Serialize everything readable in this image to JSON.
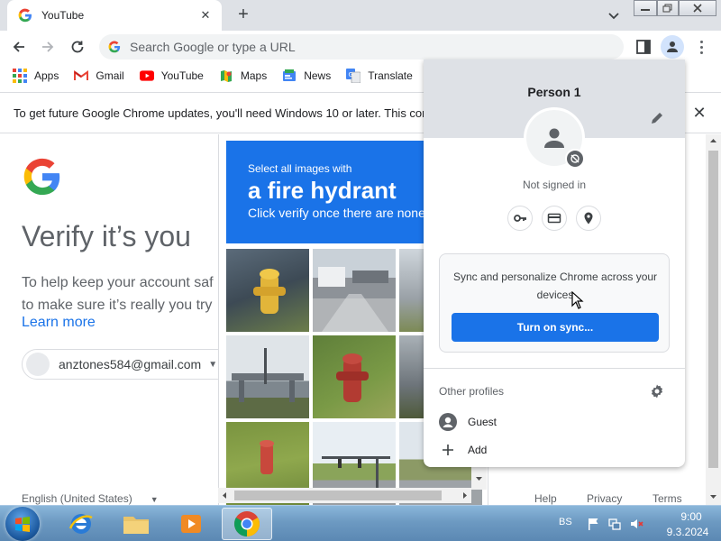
{
  "browser": {
    "tab": {
      "title": "YouTube",
      "close_glyph": "✕"
    },
    "new_tab_glyph": "+",
    "omnibox": {
      "placeholder": "Search Google or type a URL"
    },
    "window_controls": {
      "minimize": "▭",
      "restore": "❐",
      "close": "✕"
    }
  },
  "bookmarks": [
    "Apps",
    "Gmail",
    "YouTube",
    "Maps",
    "News",
    "Translate"
  ],
  "infobar": {
    "message": "To get future Google Chrome updates, you'll need Windows 10 or later. This con",
    "close_glyph": "✕"
  },
  "signin_page": {
    "title": "Verify it’s you",
    "description_line1": "To help keep your account saf",
    "description_line2": "to make sure it’s really you try",
    "learn_more": "Learn more",
    "account_email": "anztones584@gmail.com",
    "language": "English (United States)",
    "footer": {
      "help": "Help",
      "privacy": "Privacy",
      "terms": "Terms"
    }
  },
  "captcha": {
    "instruction_line1": "Select all images with",
    "target": "a fire hydrant",
    "instruction_line3": "Click verify once there are none"
  },
  "profile_menu": {
    "name": "Person 1",
    "status": "Not signed in",
    "sync_text": "Sync and personalize Chrome across your devices",
    "sync_button": "Turn on sync...",
    "other_profiles_label": "Other profiles",
    "guest_label": "Guest",
    "add_label": "Add"
  },
  "taskbar": {
    "tray_language": "BS",
    "clock_time": "9:00",
    "clock_date": "9.3.2024"
  },
  "colors": {
    "accent_blue": "#1a73e8",
    "chrome_frame": "#dee1e6",
    "taskbar": "#6d9ac2"
  }
}
